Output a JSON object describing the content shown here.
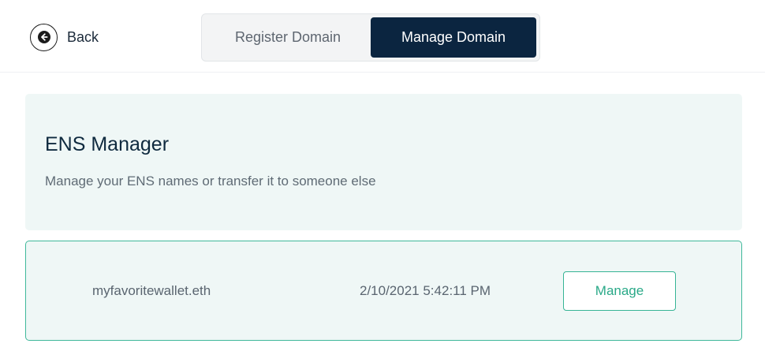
{
  "header": {
    "back_label": "Back",
    "back_icon": "arrow-left-icon",
    "tabs": [
      {
        "label": "Register Domain",
        "active": false
      },
      {
        "label": "Manage Domain",
        "active": true
      }
    ]
  },
  "panel": {
    "title": "ENS Manager",
    "subtitle": "Manage your ENS names or transfer it to someone else"
  },
  "domains": [
    {
      "name": "myfavoritewallet.eth",
      "date": "2/10/2021 5:42:11 PM",
      "action_label": "Manage"
    }
  ],
  "colors": {
    "active_tab": "#0b2540",
    "accent": "#37b495",
    "panel_bg": "#eff7f6"
  }
}
